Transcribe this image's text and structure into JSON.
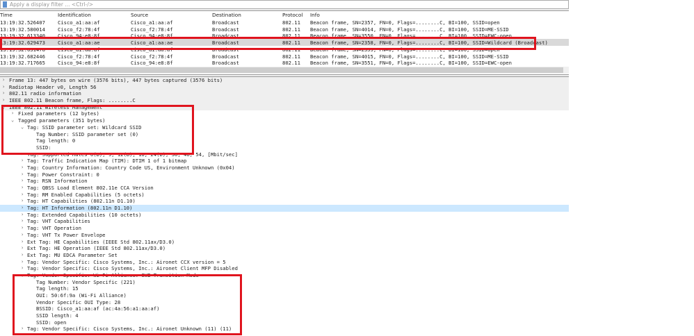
{
  "filter": {
    "placeholder": "Apply a display filter ... <Ctrl-/>"
  },
  "columns": [
    "Time",
    "Identification",
    "Source",
    "Destination",
    "Protocol",
    "Info"
  ],
  "packets": [
    [
      "13:19:32.526407",
      "Cisco_a1:aa:af",
      "Cisco_a1:aa:af",
      "Broadcast",
      "802.11",
      "Beacon frame, SN=2357, FN=0, Flags=........C, BI=100, SSID=open"
    ],
    [
      "13:19:32.580014",
      "Cisco_f2:78:4f",
      "Cisco_f2:78:4f",
      "Broadcast",
      "802.11",
      "Beacon frame, SN=4014, FN=0, Flags=........C, BI=100, SSID=ME-SSID"
    ],
    [
      "13:19:32.613340",
      "Cisco_94:e8:8f",
      "Cisco_94:e8:8f",
      "Broadcast",
      "802.11",
      "Beacon frame, SN=3550, FN=0, Flags=........C, BI=100, SSID=EWC-open"
    ],
    [
      "13:19:32.629473",
      "Cisco_a1:aa:ae",
      "Cisco_a1:aa:ae",
      "Broadcast",
      "802.11",
      "Beacon frame, SN=2358, FN=0, Flags=........C, BI=100, SSID=Wildcard (Broadcast)"
    ],
    [
      "13:19:32.631478",
      "Cisco_a1:aa:af",
      "Cisco_a1:aa:af",
      "Broadcast",
      "802.11",
      "Beacon frame, SN=2359, FN=0, Flags=........C, BI=100, SSID=open"
    ],
    [
      "13:19:32.682446",
      "Cisco_f2:78:4f",
      "Cisco_f2:78:4f",
      "Broadcast",
      "802.11",
      "Beacon frame, SN=4015, FN=0, Flags=........C, BI=100, SSID=ME-SSID"
    ],
    [
      "13:19:32.717665",
      "Cisco_94:e8:8f",
      "Cisco_94:e8:8f",
      "Broadcast",
      "802.11",
      "Beacon frame, SN=3551, FN=0, Flags=........C, BI=100, SSID=EWC-open"
    ]
  ],
  "selected_packet": 3,
  "details": [
    {
      "l": 0,
      "a": ">",
      "t": "Frame 13: 447 bytes on wire (3576 bits), 447 bytes captured (3576 bits)"
    },
    {
      "l": 0,
      "a": ">",
      "t": "Radiotap Header v0, Length 56"
    },
    {
      "l": 0,
      "a": ">",
      "t": "802.11 radio information"
    },
    {
      "l": 0,
      "a": ">",
      "t": "IEEE 802.11 Beacon frame, Flags: ........C"
    },
    {
      "l": 0,
      "a": "v",
      "t": "IEEE 802.11 Wireless Management"
    },
    {
      "l": 1,
      "a": ">",
      "t": "Fixed parameters (12 bytes)"
    },
    {
      "l": 1,
      "a": "v",
      "t": "Tagged parameters (351 bytes)"
    },
    {
      "l": 2,
      "a": "v",
      "t": "Tag: SSID parameter set: Wildcard SSID"
    },
    {
      "l": 3,
      "a": "",
      "t": "Tag Number: SSID parameter set (0)"
    },
    {
      "l": 3,
      "a": "",
      "t": "Tag length: 0"
    },
    {
      "l": 3,
      "a": "",
      "t": "SSID:"
    },
    {
      "l": 2,
      "a": ">",
      "t": "Tag: Supported Rates 6(B), 9, 12(B), 18, 24(B), 36, 48, 54, [Mbit/sec]"
    },
    {
      "l": 2,
      "a": ">",
      "t": "Tag: Traffic Indication Map (TIM): DTIM 1 of 1 bitmap"
    },
    {
      "l": 2,
      "a": ">",
      "t": "Tag: Country Information: Country Code US, Environment Unknown (0x04)"
    },
    {
      "l": 2,
      "a": ">",
      "t": "Tag: Power Constraint: 0"
    },
    {
      "l": 2,
      "a": ">",
      "t": "Tag: RSN Information"
    },
    {
      "l": 2,
      "a": ">",
      "t": "Tag: QBSS Load Element 802.11e CCA Version"
    },
    {
      "l": 2,
      "a": ">",
      "t": "Tag: RM Enabled Capabilities (5 octets)"
    },
    {
      "l": 2,
      "a": ">",
      "t": "Tag: HT Capabilities (802.11n D1.10)"
    },
    {
      "l": 2,
      "a": ">",
      "t": "Tag: HT Information (802.11n D1.10)"
    },
    {
      "l": 2,
      "a": ">",
      "t": "Tag: Extended Capabilities (10 octets)"
    },
    {
      "l": 2,
      "a": ">",
      "t": "Tag: VHT Capabilities"
    },
    {
      "l": 2,
      "a": ">",
      "t": "Tag: VHT Operation"
    },
    {
      "l": 2,
      "a": ">",
      "t": "Tag: VHT Tx Power Envelope"
    },
    {
      "l": 2,
      "a": ">",
      "t": "Ext Tag: HE Capabilities (IEEE Std 802.11ax/D3.0)"
    },
    {
      "l": 2,
      "a": ">",
      "t": "Ext Tag: HE Operation (IEEE Std 802.11ax/D3.0)"
    },
    {
      "l": 2,
      "a": ">",
      "t": "Ext Tag: MU EDCA Parameter Set"
    },
    {
      "l": 2,
      "a": ">",
      "t": "Tag: Vendor Specific: Cisco Systems, Inc.: Aironet CCX version = 5"
    },
    {
      "l": 2,
      "a": ">",
      "t": "Tag: Vendor Specific: Cisco Systems, Inc.: Aironet Client MFP Disabled"
    },
    {
      "l": 2,
      "a": "v",
      "t": "Tag: Vendor Specific: Wi-Fi Alliance: OWE Transition Mode"
    },
    {
      "l": 3,
      "a": "",
      "t": "Tag Number: Vendor Specific (221)"
    },
    {
      "l": 3,
      "a": "",
      "t": "Tag length: 15"
    },
    {
      "l": 3,
      "a": "",
      "t": "OUI: 50:6f:9a (Wi-Fi Alliance)"
    },
    {
      "l": 3,
      "a": "",
      "t": "Vendor Specific OUI Type: 28"
    },
    {
      "l": 3,
      "a": "",
      "t": "BSSID: Cisco_a1:aa:af (ac:4a:56:a1:aa:af)"
    },
    {
      "l": 3,
      "a": "",
      "t": "SSID length: 4"
    },
    {
      "l": 3,
      "a": "",
      "t": "SSID: open"
    },
    {
      "l": 2,
      "a": ">",
      "t": "Tag: Vendor Specific: Cisco Systems, Inc.: Aironet Unknown (11) (11)"
    }
  ],
  "selected_detail": 19,
  "colors": {
    "highlight_box": "#e0141e",
    "selected_detail": "#cce8ff",
    "selected_packet": "#d9d9d9"
  }
}
